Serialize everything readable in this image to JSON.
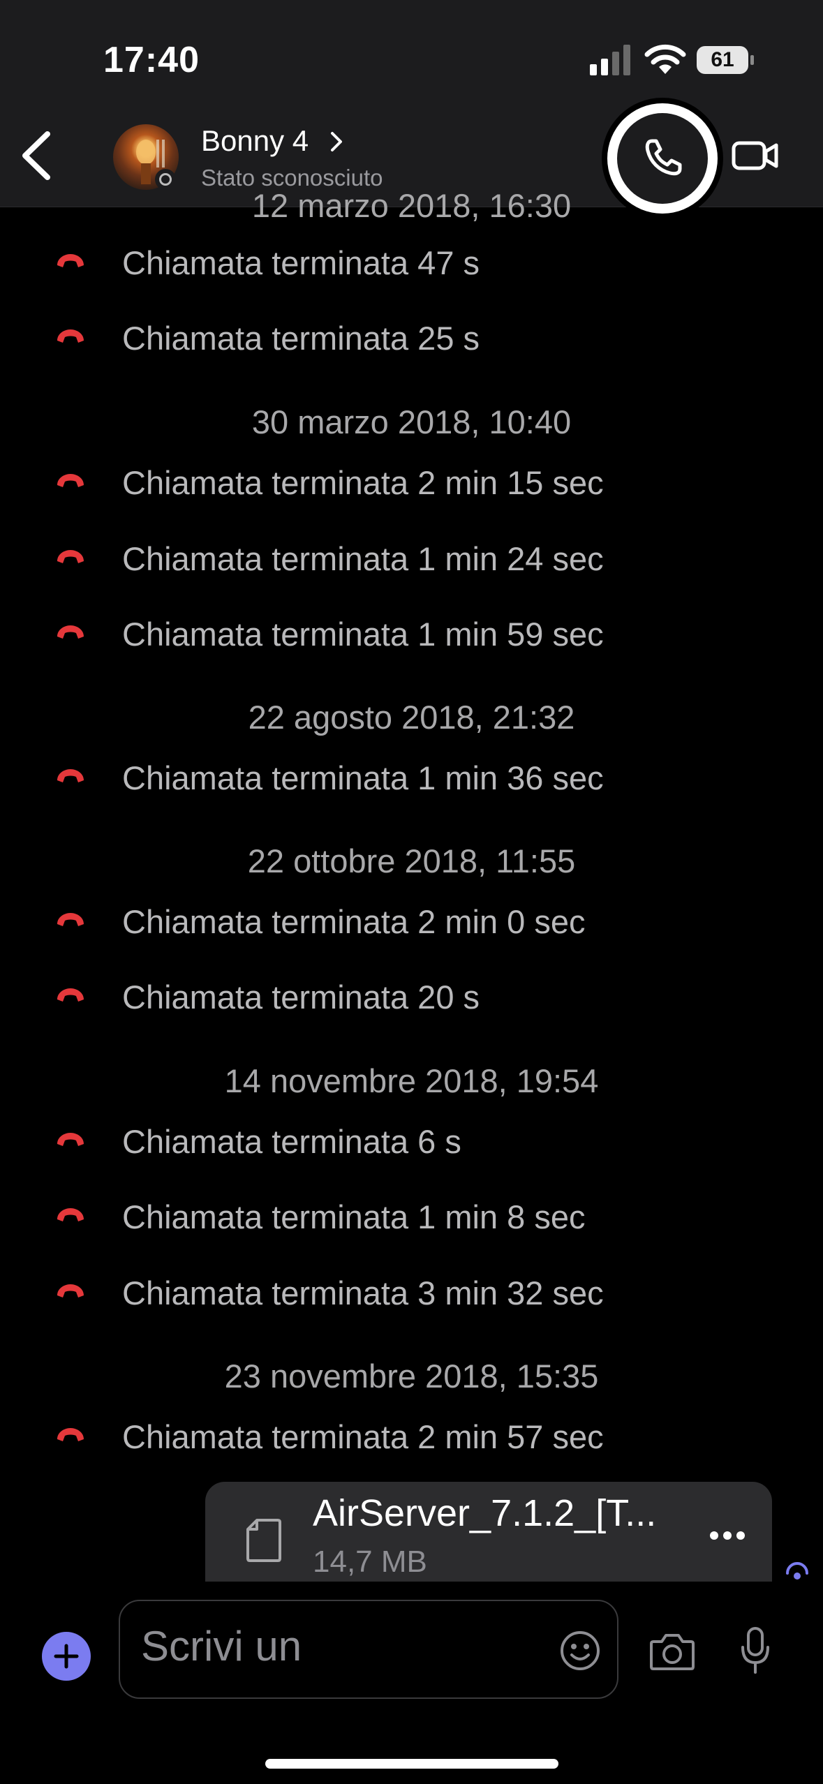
{
  "status_bar": {
    "time": "17:40",
    "battery": "61"
  },
  "header": {
    "contact_name": "Bonny 4",
    "contact_status": "Stato sconosciuto",
    "icons": {
      "back": "chevron-left-icon",
      "call": "phone-icon",
      "video": "video-camera-icon"
    }
  },
  "chat": {
    "partial_date": "12 marzo 2018, 16:30",
    "items": [
      {
        "type": "call",
        "text": "Chiamata terminata 47 s"
      },
      {
        "type": "call",
        "text": "Chiamata terminata 25 s"
      },
      {
        "type": "date",
        "text": "30 marzo 2018, 10:40"
      },
      {
        "type": "call",
        "text": "Chiamata terminata 2 min 15 sec"
      },
      {
        "type": "call",
        "text": "Chiamata terminata 1 min 24 sec"
      },
      {
        "type": "call",
        "text": "Chiamata terminata 1 min 59 sec"
      },
      {
        "type": "date",
        "text": "22 agosto 2018, 21:32"
      },
      {
        "type": "call",
        "text": "Chiamata terminata 1 min 36 sec"
      },
      {
        "type": "date",
        "text": "22 ottobre 2018, 11:55"
      },
      {
        "type": "call",
        "text": "Chiamata terminata 2 min 0 sec"
      },
      {
        "type": "call",
        "text": "Chiamata terminata 20 s"
      },
      {
        "type": "date",
        "text": "14 novembre 2018, 19:54"
      },
      {
        "type": "call",
        "text": "Chiamata terminata 6 s"
      },
      {
        "type": "call",
        "text": "Chiamata terminata 1 min 8 sec"
      },
      {
        "type": "call",
        "text": "Chiamata terminata 3 min 32 sec"
      },
      {
        "type": "date",
        "text": "23 novembre 2018, 15:35"
      },
      {
        "type": "call",
        "text": "Chiamata terminata 2 min 57 sec"
      }
    ],
    "file": {
      "name": "AirServer_7.1.2_[T...",
      "size": "14,7 MB"
    }
  },
  "composer": {
    "placeholder": "Scrivi un",
    "icons": {
      "plus": "plus-icon",
      "emoji": "emoji-icon",
      "camera": "camera-icon",
      "mic": "microphone-icon"
    }
  },
  "colors": {
    "accent": "#7b7cf0",
    "missed_call": "#e5383b",
    "header_bg": "#1c1c1e",
    "file_bubble": "#2c2c2e"
  }
}
